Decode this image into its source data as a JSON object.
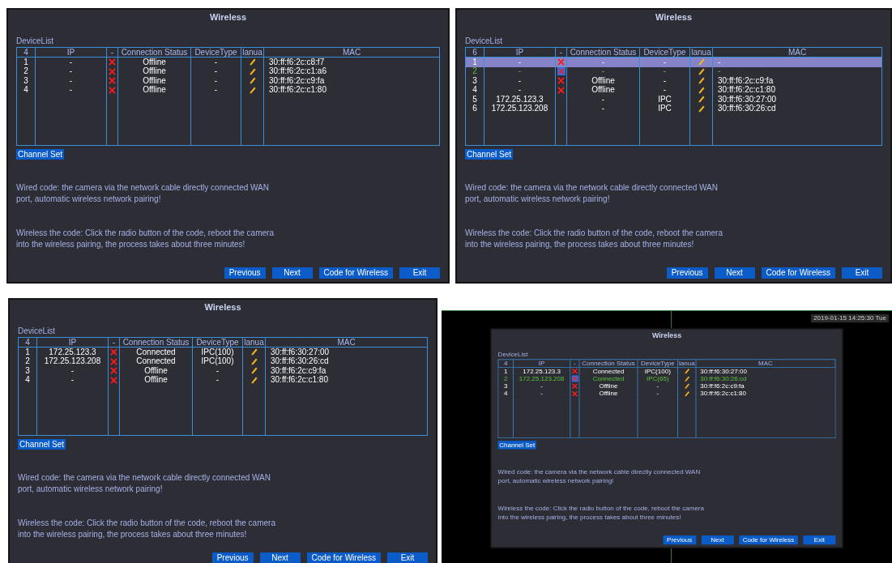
{
  "panels": [
    {
      "title": "Wireless",
      "list_label": "DeviceList",
      "columns": [
        "4",
        "IP",
        "-",
        "Connection Status",
        "DeviceType",
        "lanua",
        "MAC"
      ],
      "rows": [
        {
          "no": "1",
          "ip": "-",
          "kind": "x",
          "status": "Offline",
          "type": "-",
          "mac": "30:ff:f6:2c:c8:f7",
          "selected": false,
          "highlighted": false
        },
        {
          "no": "2",
          "ip": "-",
          "kind": "x",
          "status": "Offline",
          "type": "-",
          "mac": "30:ff:f6:2c:c1:a6",
          "selected": false,
          "highlighted": false
        },
        {
          "no": "3",
          "ip": "-",
          "kind": "x",
          "status": "Offline",
          "type": "-",
          "mac": "30:ff:f6:2c:c9:fa",
          "selected": false,
          "highlighted": false
        },
        {
          "no": "4",
          "ip": "-",
          "kind": "x",
          "status": "Offline",
          "type": "-",
          "mac": "30:ff:f6:2c:c1:80",
          "selected": false,
          "highlighted": false
        }
      ],
      "channel_button": "Channel Set",
      "paragraphs": [
        "Wired code: the camera via the network cable directly connected WAN port, automatic wireless network pairing!",
        "Wireless the code: Click the radio button of the code, reboot the camera into the wireless pairing, the process takes about three minutes!"
      ],
      "buttons": [
        "Previous",
        "Next",
        "Code for Wireless",
        "Exit"
      ]
    },
    {
      "title": "Wireless",
      "list_label": "DeviceList",
      "columns": [
        "6",
        "IP",
        "-",
        "Connection Status",
        "DeviceType",
        "lanua",
        "MAC"
      ],
      "rows": [
        {
          "no": "1",
          "ip": "-",
          "kind": "x",
          "status": "-",
          "type": "-",
          "mac": "-",
          "selected": true,
          "highlighted": false
        },
        {
          "no": "2",
          "ip": "-",
          "kind": "boxed_x",
          "status": "-",
          "type": "-",
          "mac": "-",
          "selected": false,
          "highlighted": true
        },
        {
          "no": "3",
          "ip": "-",
          "kind": "x",
          "status": "Offline",
          "type": "-",
          "mac": "30:ff:f6:2c:c9:fa",
          "selected": false,
          "highlighted": false
        },
        {
          "no": "4",
          "ip": "-",
          "kind": "x",
          "status": "Offline",
          "type": "-",
          "mac": "30:ff:f6:2c:c1:80",
          "selected": false,
          "highlighted": false
        },
        {
          "no": "5",
          "ip": "172.25.123.3",
          "kind": "plain",
          "status": "-",
          "type": "IPC",
          "mac": "30:ff:f6:30:27:00",
          "selected": false,
          "highlighted": false
        },
        {
          "no": "6",
          "ip": "172.25.123.208",
          "kind": "plain",
          "status": "-",
          "type": "IPC",
          "mac": "30:ff:f6:30:26:cd",
          "selected": false,
          "highlighted": false
        }
      ],
      "channel_button": "Channel Set",
      "paragraphs": [
        "Wired code: the camera via the network cable directly connected WAN port, automatic wireless network pairing!",
        "Wireless the code: Click the radio button of the code, reboot the camera into the wireless pairing, the process takes about three minutes!"
      ],
      "buttons": [
        "Previous",
        "Next",
        "Code for Wireless",
        "Exit"
      ]
    },
    {
      "title": "Wireless",
      "list_label": "DeviceList",
      "columns": [
        "4",
        "IP",
        "-",
        "Connection Status",
        "DeviceType",
        "lanua",
        "MAC"
      ],
      "rows": [
        {
          "no": "1",
          "ip": "172.25.123.3",
          "kind": "x",
          "status": "Connected",
          "type": "IPC(100)",
          "mac": "30:ff:f6:30:27:00",
          "selected": false,
          "highlighted": false
        },
        {
          "no": "2",
          "ip": "172.25.123.208",
          "kind": "x",
          "status": "Connected",
          "type": "IPC(100)",
          "mac": "30:ff:f6:30:26:cd",
          "selected": false,
          "highlighted": false
        },
        {
          "no": "3",
          "ip": "-",
          "kind": "x",
          "status": "Offline",
          "type": "-",
          "mac": "30:ff:f6:2c:c9:fa",
          "selected": false,
          "highlighted": false
        },
        {
          "no": "4",
          "ip": "-",
          "kind": "x",
          "status": "Offline",
          "type": "-",
          "mac": "30:ff:f6:2c:c1:80",
          "selected": false,
          "highlighted": false
        }
      ],
      "channel_button": "Channel Set",
      "paragraphs": [
        "Wired code: the camera via the network cable directly connected WAN port, automatic wireless network pairing!",
        "Wireless the code: Click the radio button of the code, reboot the camera into the wireless pairing, the process takes about three minutes!"
      ],
      "buttons": [
        "Previous",
        "Next",
        "Code for Wireless",
        "Exit"
      ]
    }
  ],
  "screen": {
    "timestamp": "2019-01-15 14:25:30 Tue",
    "panel": {
      "title": "Wireless",
      "list_label": "DeviceList",
      "columns": [
        "4",
        "IP",
        "-",
        "Connection Status",
        "DeviceType",
        "lanua",
        "MAC"
      ],
      "rows": [
        {
          "no": "1",
          "ip": "172.25.123.3",
          "kind": "x",
          "status": "Connected",
          "type": "IPC(100)",
          "mac": "30:ff:f6:30:27:00",
          "selected": false,
          "highlighted": false
        },
        {
          "no": "2",
          "ip": "172.25.123.208",
          "kind": "boxed_x",
          "status": "Connected",
          "type": "IPC(65)",
          "mac": "30:ff:f6:30:26:cd",
          "selected": false,
          "highlighted": true
        },
        {
          "no": "3",
          "ip": "-",
          "kind": "x",
          "status": "Offline",
          "type": "-",
          "mac": "30:ff:f6:2c:c9:fa",
          "selected": false,
          "highlighted": false
        },
        {
          "no": "4",
          "ip": "-",
          "kind": "x",
          "status": "Offline",
          "type": "-",
          "mac": "30:ff:f6:2c:c1:80",
          "selected": false,
          "highlighted": false
        }
      ],
      "channel_button": "Channel Set",
      "paragraphs": [
        "Wired code: the camera via the network cable directly connected WAN port, automatic wireless network pairing!",
        "Wireless the code: Click the radio button of the code, reboot the camera into the wireless pairing, the process takes about three minutes!"
      ],
      "buttons": [
        "Previous",
        "Next",
        "Code for Wireless",
        "Exit"
      ]
    }
  }
}
